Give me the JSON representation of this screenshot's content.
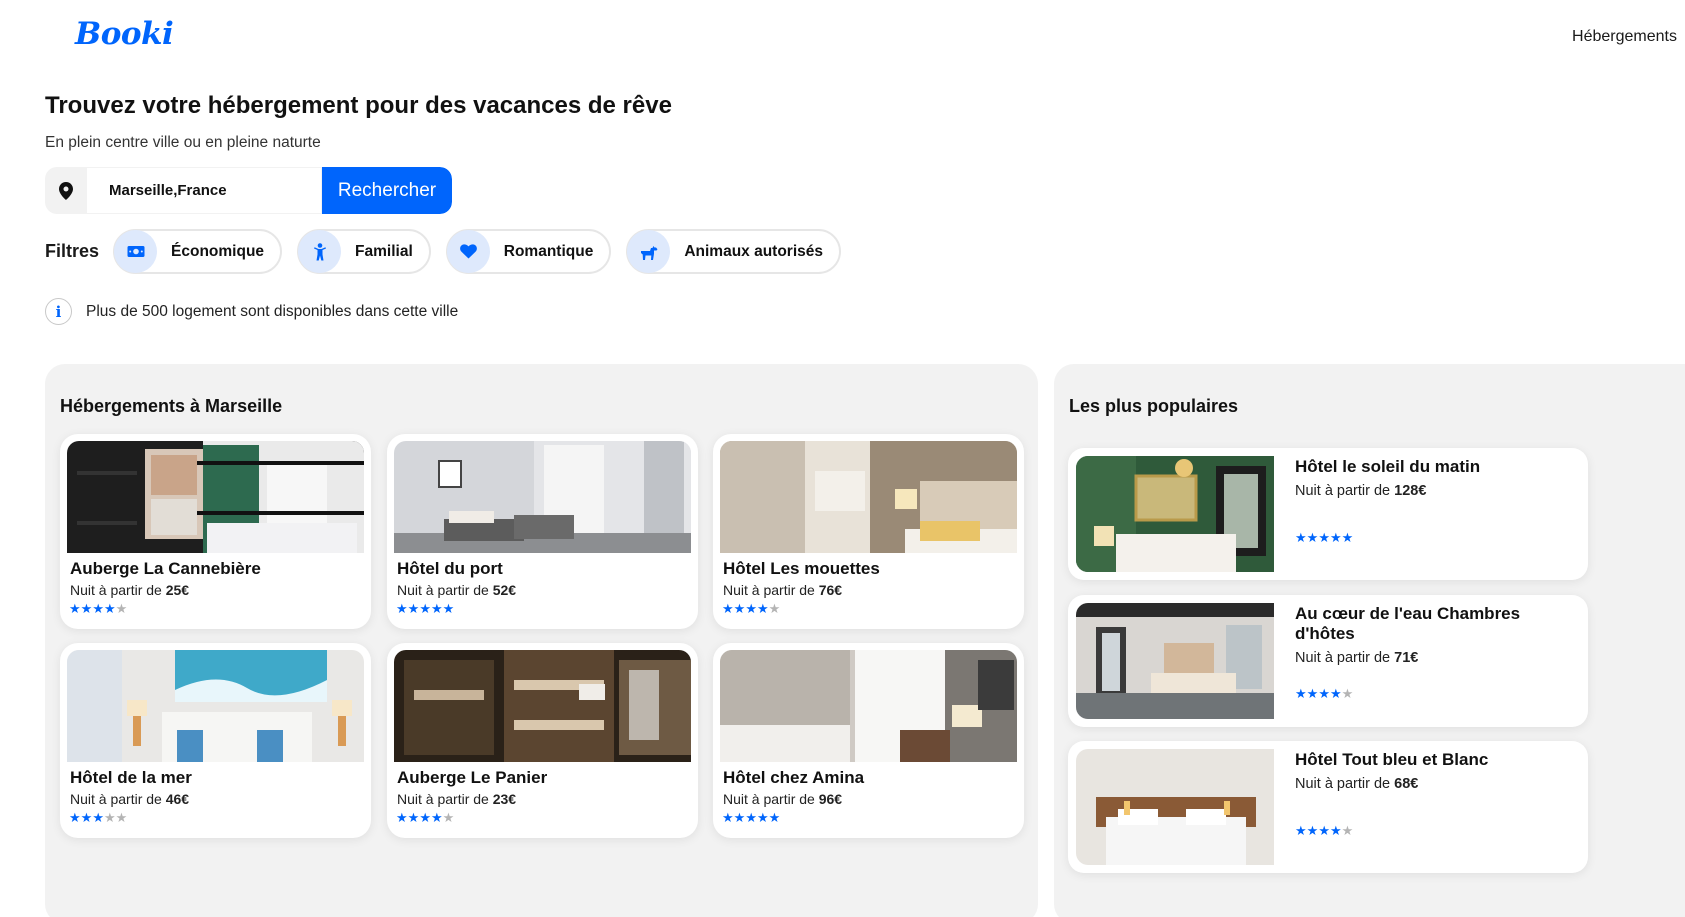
{
  "header": {
    "logo": "Booki",
    "nav_link": "Hébergements"
  },
  "hero": {
    "title": "Trouvez votre hébergement pour des vacances de rêve",
    "subtitle": "En plein centre ville ou en pleine naturte"
  },
  "search": {
    "value": "Marseille,France",
    "button_label": "Rechercher",
    "pin_icon": "map-pin-icon"
  },
  "filters": {
    "label": "Filtres",
    "items": [
      {
        "label": "Économique",
        "icon": "money-icon"
      },
      {
        "label": "Familial",
        "icon": "child-icon"
      },
      {
        "label": "Romantique",
        "icon": "heart-icon"
      },
      {
        "label": "Animaux autorisés",
        "icon": "dog-icon"
      }
    ]
  },
  "info": {
    "icon": "info-icon",
    "text": "Plus de 500 logement sont disponibles dans cette ville"
  },
  "accommodations": {
    "title": "Hébergements à Marseille",
    "price_prefix": "Nuit à partir de ",
    "items": [
      {
        "name": "Auberge La Cannebière",
        "price": "25€",
        "rating": 4
      },
      {
        "name": "Hôtel du port",
        "price": "52€",
        "rating": 5
      },
      {
        "name": "Hôtel Les mouettes",
        "price": "76€",
        "rating": 4
      },
      {
        "name": "Hôtel de la mer",
        "price": "46€",
        "rating": 3
      },
      {
        "name": "Auberge Le Panier",
        "price": "23€",
        "rating": 4
      },
      {
        "name": "Hôtel chez Amina",
        "price": "96€",
        "rating": 5
      }
    ]
  },
  "popular": {
    "title": "Les plus populaires",
    "price_prefix": "Nuit à partir de ",
    "items": [
      {
        "name": "Hôtel le soleil du matin",
        "price": "128€",
        "rating": 5
      },
      {
        "name": "Au cœur de l'eau Chambres d'hôtes",
        "price": "71€",
        "rating": 4
      },
      {
        "name": "Hôtel Tout bleu et Blanc",
        "price": "68€",
        "rating": 4
      }
    ]
  },
  "colors": {
    "accent": "#0065fc",
    "chip_icon_bg": "#dee9fc",
    "panel_bg": "#f2f2f2",
    "star_off": "#b4b4b4"
  }
}
